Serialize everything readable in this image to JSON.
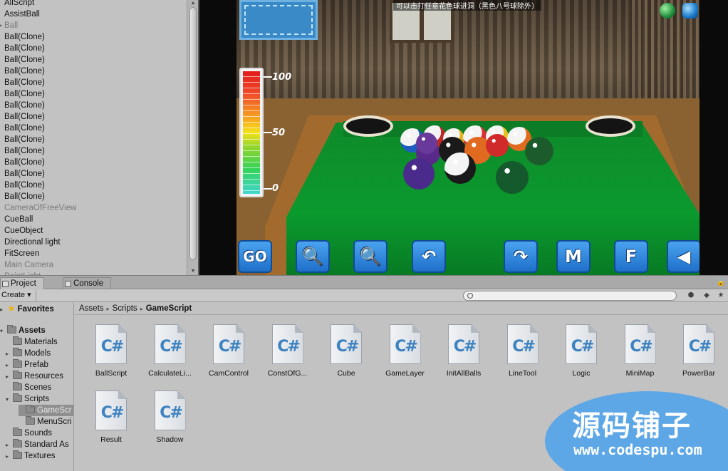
{
  "hierarchy": {
    "items": [
      {
        "label": "AllScript",
        "dim": false,
        "arrow": false
      },
      {
        "label": "AssistBall",
        "dim": false,
        "arrow": false
      },
      {
        "label": "Ball",
        "dim": true,
        "arrow": true
      },
      {
        "label": "Ball(Clone)",
        "dim": false,
        "arrow": false
      },
      {
        "label": "Ball(Clone)",
        "dim": false,
        "arrow": false
      },
      {
        "label": "Ball(Clone)",
        "dim": false,
        "arrow": false
      },
      {
        "label": "Ball(Clone)",
        "dim": false,
        "arrow": false
      },
      {
        "label": "Ball(Clone)",
        "dim": false,
        "arrow": false
      },
      {
        "label": "Ball(Clone)",
        "dim": false,
        "arrow": false
      },
      {
        "label": "Ball(Clone)",
        "dim": false,
        "arrow": false
      },
      {
        "label": "Ball(Clone)",
        "dim": false,
        "arrow": false
      },
      {
        "label": "Ball(Clone)",
        "dim": false,
        "arrow": false
      },
      {
        "label": "Ball(Clone)",
        "dim": false,
        "arrow": false
      },
      {
        "label": "Ball(Clone)",
        "dim": false,
        "arrow": false
      },
      {
        "label": "Ball(Clone)",
        "dim": false,
        "arrow": false
      },
      {
        "label": "Ball(Clone)",
        "dim": false,
        "arrow": false
      },
      {
        "label": "Ball(Clone)",
        "dim": false,
        "arrow": false
      },
      {
        "label": "Ball(Clone)",
        "dim": false,
        "arrow": false
      },
      {
        "label": "CameraOfFreeView",
        "dim": true,
        "arrow": false
      },
      {
        "label": "CueBall",
        "dim": false,
        "arrow": false
      },
      {
        "label": "CueObject",
        "dim": false,
        "arrow": false
      },
      {
        "label": "Directional light",
        "dim": false,
        "arrow": false
      },
      {
        "label": "FitScreen",
        "dim": false,
        "arrow": false
      },
      {
        "label": "Main Camera",
        "dim": true,
        "arrow": false
      },
      {
        "label": "PointLight",
        "dim": true,
        "arrow": false
      }
    ]
  },
  "game": {
    "hint_text": "可以击打任意花色球进洞（黑色八号球除外）",
    "power_labels": [
      "100",
      "50",
      "0"
    ],
    "buttons": [
      {
        "name": "go-button",
        "label": "GO"
      },
      {
        "name": "zoom-out-button",
        "label": "🔍"
      },
      {
        "name": "zoom-in-button",
        "label": "🔍"
      },
      {
        "name": "undo-button",
        "label": "↶"
      },
      {
        "name": "redo-button",
        "label": "↷"
      },
      {
        "name": "m-button",
        "label": "M"
      },
      {
        "name": "f-button",
        "label": "F"
      },
      {
        "name": "sound-button",
        "label": "◀"
      }
    ],
    "colors": {
      "felt": "#0b9a2e",
      "rail": "#a36a2e",
      "button": "#1e6fc9"
    }
  },
  "tabs": {
    "project": "Project",
    "console": "Console"
  },
  "toolbar": {
    "create_label": "Create ▾"
  },
  "folders": {
    "favorites": "Favorites",
    "assets": "Assets",
    "items": [
      {
        "label": "Materials",
        "arrow": "",
        "indent": 1,
        "selected": false
      },
      {
        "label": "Models",
        "arrow": "▸",
        "indent": 1,
        "selected": false
      },
      {
        "label": "Prefab",
        "arrow": "▸",
        "indent": 1,
        "selected": false
      },
      {
        "label": "Resources",
        "arrow": "▸",
        "indent": 1,
        "selected": false
      },
      {
        "label": "Scenes",
        "arrow": "",
        "indent": 1,
        "selected": false
      },
      {
        "label": "Scripts",
        "arrow": "▾",
        "indent": 1,
        "selected": false
      },
      {
        "label": "GameScr",
        "arrow": "",
        "indent": 2,
        "selected": true
      },
      {
        "label": "MenuScri",
        "arrow": "",
        "indent": 2,
        "selected": false
      },
      {
        "label": "Sounds",
        "arrow": "",
        "indent": 1,
        "selected": false
      },
      {
        "label": "Standard As",
        "arrow": "▸",
        "indent": 1,
        "selected": false
      },
      {
        "label": "Textures",
        "arrow": "▸",
        "indent": 1,
        "selected": false
      }
    ]
  },
  "breadcrumb": [
    "Assets",
    "Scripts",
    "GameScript"
  ],
  "assets": {
    "glyph": "C#",
    "files": [
      "BallScript",
      "CalculateLi...",
      "CamControl",
      "ConstOfG...",
      "Cube",
      "GameLayer",
      "InitAllBalls",
      "LineTool",
      "Logic",
      "MiniMap",
      "PowerBar",
      "Result",
      "Shadow"
    ]
  },
  "watermark": {
    "title": "源码铺子",
    "url": "www.codespu.com"
  }
}
